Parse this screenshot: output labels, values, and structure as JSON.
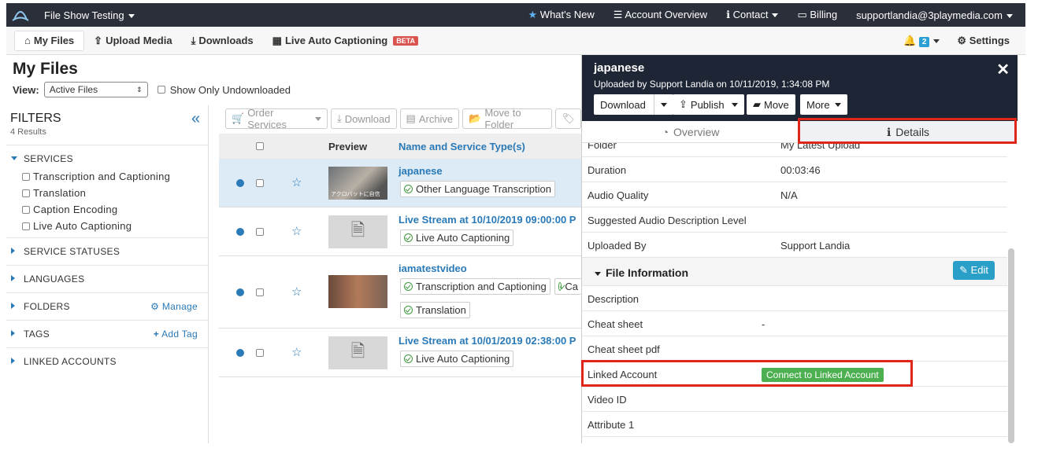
{
  "topbar": {
    "app": "File Show Testing",
    "whats_new": "What's New",
    "account_overview": "Account Overview",
    "contact": "Contact",
    "billing": "Billing",
    "user": "supportlandia@3playmedia.com"
  },
  "subnav": {
    "my_files": "My Files",
    "upload": "Upload Media",
    "downloads": "Downloads",
    "live": "Live Auto Captioning",
    "beta": "BETA",
    "notif_count": "2",
    "settings": "Settings"
  },
  "page": {
    "title": "My Files",
    "view_label": "View:",
    "view_value": "Active Files",
    "show_undl": "Show Only Undownloaded"
  },
  "filters": {
    "header": "FILTERS",
    "results": "4 Results",
    "services": "SERVICES",
    "service_items": [
      "Transcription and Captioning",
      "Translation",
      "Caption Encoding",
      "Live Auto Captioning"
    ],
    "statuses": "SERVICE STATUSES",
    "languages": "LANGUAGES",
    "folders": "FOLDERS",
    "manage": "Manage",
    "tags": "TAGS",
    "add_tag": "Add Tag",
    "linked": "LINKED ACCOUNTS"
  },
  "toolbar": {
    "order": "Order Services",
    "download": "Download",
    "archive": "Archive",
    "move": "Move to Folder"
  },
  "table": {
    "col_preview": "Preview",
    "col_name": "Name and Service Type(s)",
    "rows": [
      {
        "name": "japanese",
        "services": [
          "Other Language Transcription"
        ],
        "thumb_text": "アクロバットに自信"
      },
      {
        "name": "Live Stream at 10/10/2019 09:00:00 P",
        "services": [
          "Live Auto Captioning"
        ]
      },
      {
        "name": "iamatestvideo",
        "services": [
          "Transcription and Captioning",
          "Ca",
          "Translation"
        ]
      },
      {
        "name": "Live Stream at 10/01/2019 02:38:00 P",
        "services": [
          "Live Auto Captioning"
        ]
      }
    ]
  },
  "panel": {
    "title": "japanese",
    "subtitle": "Uploaded by Support Landia on 10/11/2019, 1:34:08 PM",
    "btn_download": "Download",
    "btn_publish": "Publish",
    "btn_move": "Move",
    "btn_more": "More",
    "tab_overview": "Overview",
    "tab_details": "Details",
    "folder_k": "Folder",
    "folder_v": "My Latest Upload",
    "rows": [
      {
        "k": "Duration",
        "v": "00:03:46"
      },
      {
        "k": "Audio Quality",
        "v": "N/A"
      },
      {
        "k": "Suggested Audio Description Level",
        "v": ""
      },
      {
        "k": "Uploaded By",
        "v": "Support Landia"
      }
    ],
    "file_info": "File Information",
    "edit": "Edit",
    "rows2": [
      {
        "k": "Description",
        "v": ""
      },
      {
        "k": "Cheat sheet",
        "v": "-"
      },
      {
        "k": "Cheat sheet pdf",
        "v": ""
      }
    ],
    "linked_k": "Linked Account",
    "linked_btn": "Connect to Linked Account",
    "rows3": [
      {
        "k": "Video ID",
        "v": ""
      },
      {
        "k": "Attribute 1",
        "v": ""
      }
    ]
  },
  "colors": {
    "accent": "#2a7ab8",
    "highlight": "#e0251b",
    "success": "#4caf50",
    "header_bg": "#1e2535"
  }
}
